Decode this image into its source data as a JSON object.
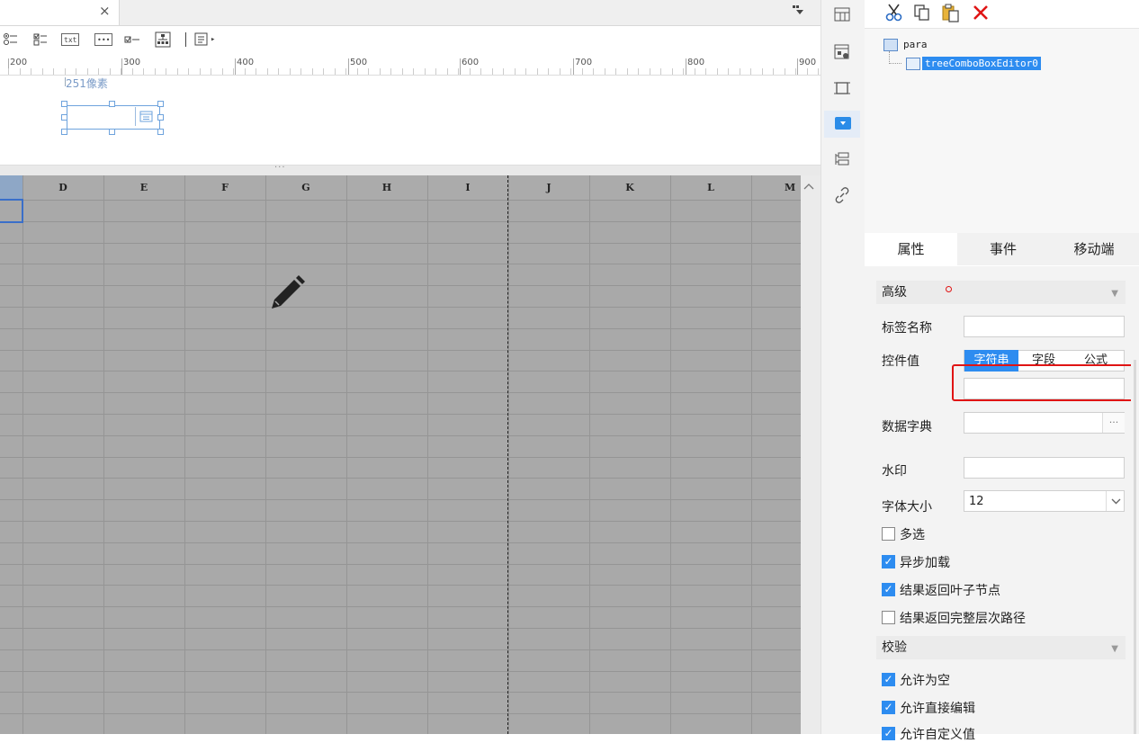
{
  "tab": {
    "close_glyph": "×"
  },
  "toolbar": {
    "icons": [
      "radio-group-icon",
      "checkbox-group-icon",
      "text-field-icon",
      "password-icon",
      "checkbox-icon",
      "tree-icon",
      "separator",
      "more-widgets-icon"
    ],
    "text_icon_label": "txt",
    "password_icon_label": "•••",
    "more_arrow": "▸"
  },
  "ruler": {
    "labels": [
      "200",
      "300",
      "400",
      "500",
      "600",
      "700",
      "800",
      "900"
    ]
  },
  "canvas": {
    "pixel_label": "251像素",
    "splitter_dots": "···"
  },
  "grid": {
    "columns": [
      "D",
      "E",
      "F",
      "G",
      "H",
      "I",
      "J",
      "K",
      "L",
      "M"
    ]
  },
  "right_panel": {
    "tree": {
      "root": "para",
      "child": "treeComboBoxEditor0"
    },
    "tabs": [
      "属性",
      "事件",
      "移动端"
    ],
    "sections": {
      "advanced": "高级",
      "validation": "校验"
    },
    "fields": {
      "label_name": "标签名称",
      "control_value": "控件值",
      "data_dict": "数据字典",
      "watermark": "水印",
      "font_size": "字体大小"
    },
    "control_value_options": [
      "字符串",
      "字段",
      "公式"
    ],
    "dict_button": "···",
    "font_size_value": "12",
    "font_size_dropdown": "∨",
    "checkboxes": [
      {
        "label": "多选",
        "checked": false
      },
      {
        "label": "异步加载",
        "checked": true
      },
      {
        "label": "结果返回叶子节点",
        "checked": true
      },
      {
        "label": "结果返回完整层次路径",
        "checked": false
      }
    ],
    "validation_checkboxes": [
      {
        "label": "允许为空",
        "checked": true
      },
      {
        "label": "允许直接编辑",
        "checked": true
      },
      {
        "label": "允许自定义值",
        "checked": true
      }
    ],
    "check_glyph": "✓"
  },
  "colors": {
    "accent": "#2d8cf0",
    "highlight_red": "#e01414",
    "grid_bg": "#a9a9a9"
  }
}
